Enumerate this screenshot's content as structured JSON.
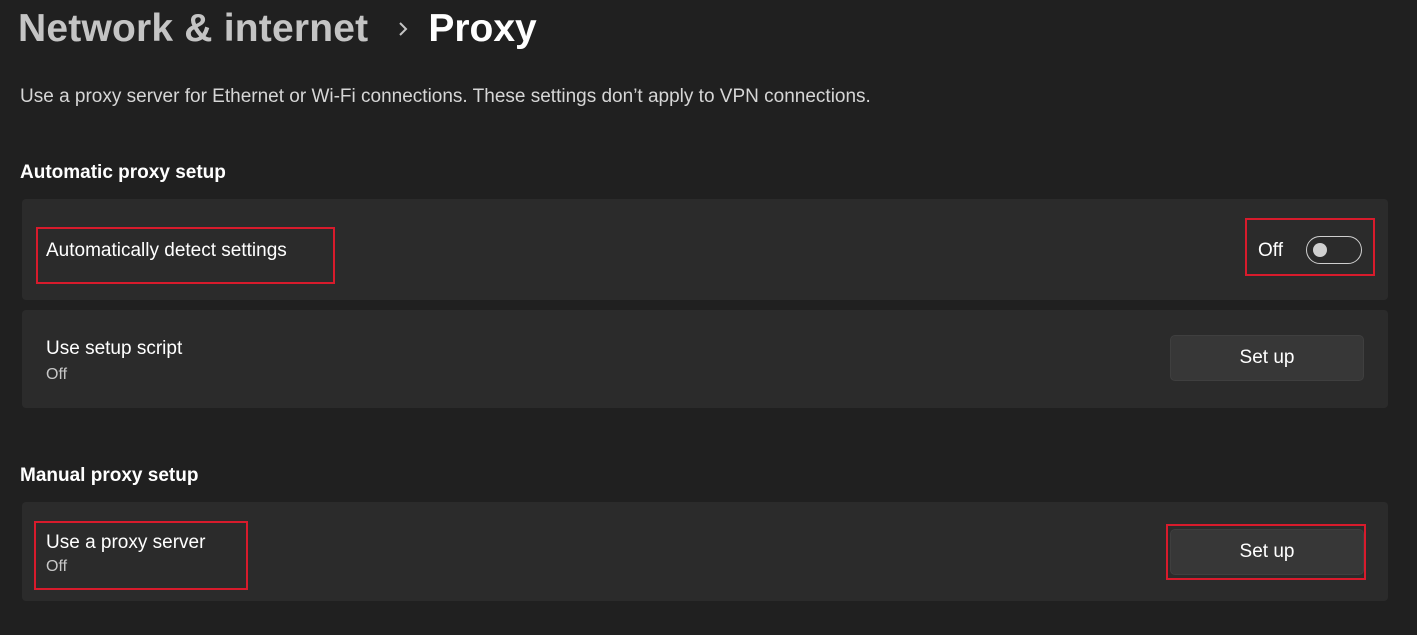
{
  "breadcrumb": {
    "parent": "Network & internet",
    "current": "Proxy"
  },
  "description": "Use a proxy server for Ethernet or Wi-Fi connections. These settings don’t apply to VPN connections.",
  "automatic": {
    "heading": "Automatic proxy setup",
    "detect": {
      "title": "Automatically detect settings",
      "state_label": "Off",
      "enabled": false
    },
    "script": {
      "title": "Use setup script",
      "status": "Off",
      "button_label": "Set up"
    }
  },
  "manual": {
    "heading": "Manual proxy setup",
    "server": {
      "title": "Use a proxy server",
      "status": "Off",
      "button_label": "Set up"
    }
  },
  "colors": {
    "background": "#202020",
    "card": "#2b2b2b",
    "button": "#373737",
    "highlight": "#d81b2c"
  },
  "icons": {
    "breadcrumb_separator": "chevron-right-icon"
  }
}
